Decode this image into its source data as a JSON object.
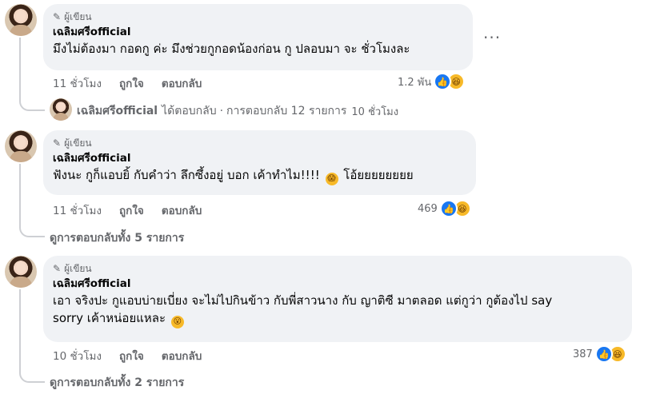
{
  "comments": [
    {
      "role": "ผู้เขียน",
      "author": "เฉลิมศรีofficial",
      "text": "มึงไม่ต้องมา กอดกู ค่ะ มึงช่วยกูกอดน้องก่อน กู ปลอบมา จะ ชั่วโมงละ",
      "time": "11 ชั่วโมง",
      "like": "ถูกใจ",
      "reply": "ตอบกลับ",
      "reaction_count": "1.2 พัน",
      "more": "···",
      "reply_preview": {
        "name": "เฉลิมศรีofficial",
        "action": "ได้ตอบกลับ",
        "sep": "·",
        "summary": "การตอบกลับ 12 รายการ",
        "time": "10 ชั่วโมง"
      }
    },
    {
      "role": "ผู้เขียน",
      "author": "เฉลิมศรีofficial",
      "text": "ฟังนะ กูก็แอบยิ้ กับคำว่า ลึกซึ้งอยู่ บอก เค้าทำไม!!!!",
      "text_after": "โอ้ยยยยยยยย",
      "time": "11 ชั่วโมง",
      "like": "ถูกใจ",
      "reply": "ตอบกลับ",
      "reaction_count": "469",
      "view_replies": "ดูการตอบกลับทั้ง 5 รายการ"
    },
    {
      "role": "ผู้เขียน",
      "author": "เฉลิมศรีofficial",
      "text_line1": "เอา จริงปะ กูแอบบ่ายเบี่ยง จะไม่ไปกินข้าว กับพี่สาวนาง กับ ญาติซี มาตลอด แต่กูว่า กูต้องไป say",
      "text_line2": "sorry เค้าหน่อยแหละ",
      "time": "10 ชั่วโมง",
      "like": "ถูกใจ",
      "reply": "ตอบกลับ",
      "reaction_count": "387",
      "view_replies": "ดูการตอบกลับทั้ง 2 รายการ"
    }
  ],
  "icons": {
    "pencil": "✎",
    "like": "👍",
    "haha": "😆",
    "emoji_c2": "😱",
    "emoji_c3": "😮"
  },
  "colors": {
    "bubble": "#f0f2f5",
    "meta_text": "#65676b",
    "like_blue": "#1877f2",
    "haha_yellow": "#f7b928"
  }
}
